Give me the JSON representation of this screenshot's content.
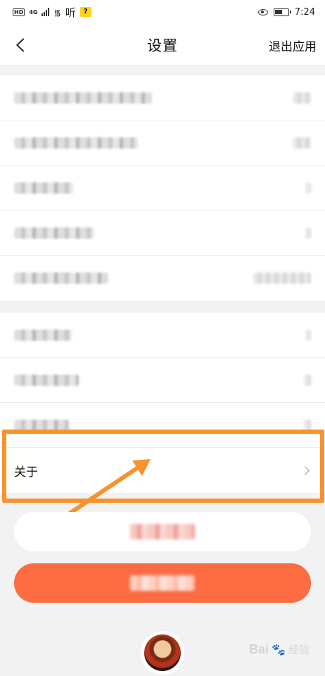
{
  "status_bar": {
    "time": "7:24",
    "network": "4G",
    "app_icon_text": "听"
  },
  "header": {
    "title": "设置",
    "exit_label": "退出应用"
  },
  "settings": {
    "about_label": "关于"
  },
  "watermark": {
    "brand": "Bai",
    "brand_suffix": "经验"
  },
  "colors": {
    "accent_orange": "#fd6b42",
    "highlight_orange": "#f7922d"
  },
  "icons": [
    "back-icon",
    "chevron-right-icon",
    "eye-icon",
    "battery-icon",
    "wifi-icon",
    "signal-icon"
  ]
}
